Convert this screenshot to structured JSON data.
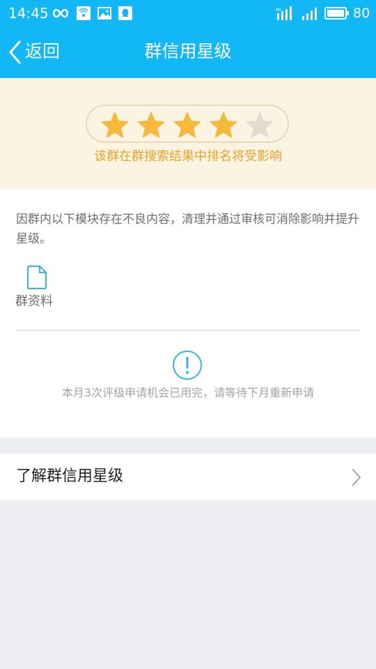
{
  "status_bar": {
    "time": "14:45",
    "battery_level": "80",
    "left_icons": [
      "infinity-icon",
      "wifi-hotspot-icon",
      "image-icon",
      "qq-icon"
    ],
    "right_icons": [
      "signal-4g-icon",
      "signal-icon",
      "battery-icon"
    ]
  },
  "nav": {
    "back_label": "返回",
    "title": "群信用星级"
  },
  "rating": {
    "stars_total": 5,
    "stars_filled": 4,
    "notice": "该群在群搜索结果中排名将受影响"
  },
  "modules": {
    "description": "因群内以下模块存在不良内容，清理并通过审核可消除影响并提升星级。",
    "items": [
      {
        "label": "群资料",
        "icon": "document-icon"
      }
    ]
  },
  "appeal": {
    "icon": "exclamation-icon",
    "message": "本月3次评级申请机会已用完，请等待下月重新申请"
  },
  "learn_more": {
    "label": "了解群信用星级"
  },
  "colors": {
    "header": "#12b7f5",
    "star_filled": "#f6b93b",
    "star_empty": "#e3ddd1",
    "notice": "#e8a22a",
    "accent_icon": "#33b6d9"
  }
}
